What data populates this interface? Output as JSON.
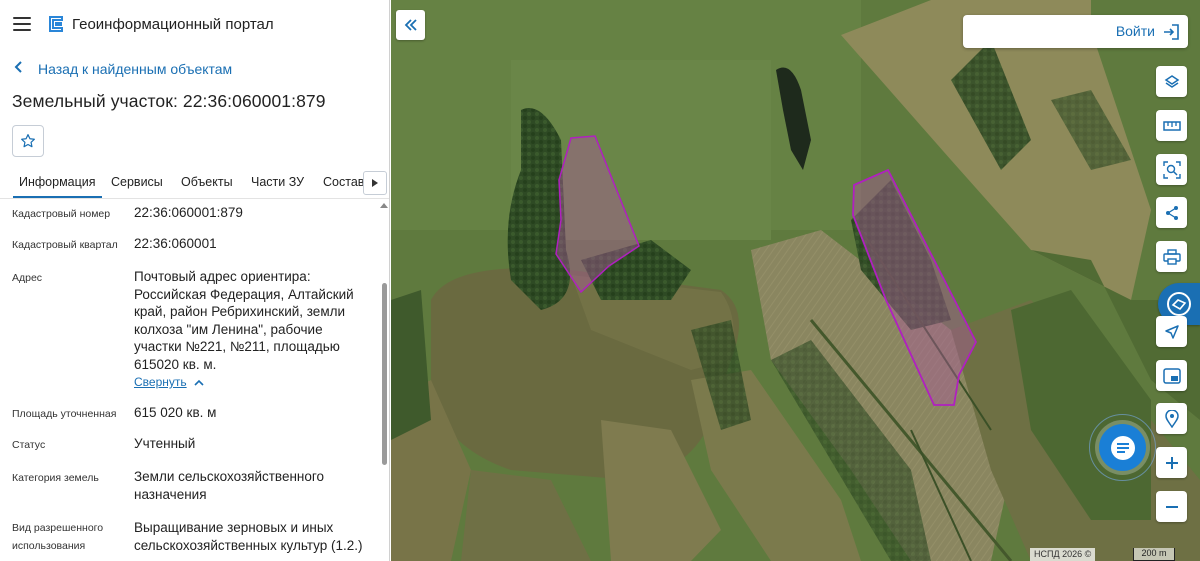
{
  "app": {
    "title": "Геоинформационный портал"
  },
  "nav": {
    "back_label": "Назад к найденным объектам"
  },
  "page": {
    "title": "Земельный участок: 22:36:060001:879"
  },
  "tabs": [
    {
      "label": "Информация",
      "active": true
    },
    {
      "label": "Сервисы",
      "active": false
    },
    {
      "label": "Объекты",
      "active": false
    },
    {
      "label": "Части ЗУ",
      "active": false
    },
    {
      "label": "Состав",
      "active": false
    }
  ],
  "properties": [
    {
      "label": "Кадастровый номер",
      "value": "22:36:060001:879"
    },
    {
      "label": "Кадастровый квартал",
      "value": "22:36:060001"
    },
    {
      "label": "Адрес",
      "value_lines": [
        "Почтовый адрес ориентира:",
        "Российская Федерация, Алтайский",
        "край, район Ребрихинский, земли",
        "колхоза \"им Ленина\", рабочие",
        "участки №221, №211, площадью",
        "615020 кв. м."
      ],
      "toggle_label": "Свернуть"
    },
    {
      "label": "Площадь уточненная",
      "value": "615 020 кв. м"
    },
    {
      "label": "Статус",
      "value": "Учтенный"
    },
    {
      "label": "Категория земель",
      "value_lines": [
        "Земли сельскохозяйственного",
        "назначения"
      ]
    },
    {
      "label_lines": [
        "Вид разрешенного",
        "использования"
      ],
      "value_lines": [
        "Выращивание зерновых и иных",
        "сельскохозяйственных культур (1.2.)"
      ]
    }
  ],
  "map": {
    "login_label": "Войти",
    "attribution": "НСПД 2026 ©",
    "scale_label": "200 m",
    "tools": [
      "layers-icon",
      "ruler-icon",
      "search-area-icon",
      "share-icon",
      "print-icon",
      "feedback-icon",
      "navigate-icon",
      "picture-in-picture-icon",
      "location-pin-icon",
      "zoom-in-icon",
      "zoom-out-icon"
    ],
    "colors": {
      "accent": "#1a6fb3",
      "parcel_stroke": "#b020c0",
      "parcel_fill": "#a85a9a"
    }
  }
}
